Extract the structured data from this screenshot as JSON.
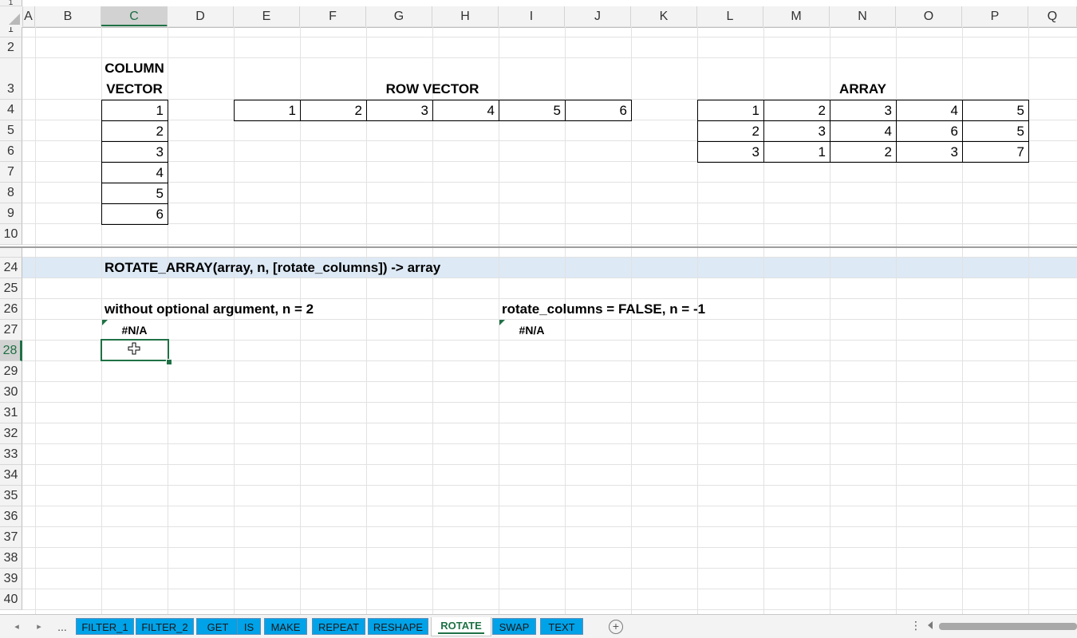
{
  "columns": [
    "A",
    "B",
    "C",
    "D",
    "E",
    "F",
    "G",
    "H",
    "I",
    "J",
    "K",
    "L",
    "M",
    "N",
    "O",
    "P",
    "Q"
  ],
  "selected_column": "C",
  "rows_top": [
    "1",
    "2",
    "3",
    "4",
    "5",
    "6",
    "7",
    "8",
    "9",
    "10"
  ],
  "rows_bottom": [
    "24",
    "25",
    "26",
    "27",
    "28",
    "29",
    "30",
    "31",
    "32",
    "33",
    "34",
    "35",
    "36",
    "37",
    "38",
    "39",
    "40"
  ],
  "selected_row": "28",
  "header_frozen_row": "1",
  "labels": {
    "column_vector_line1": "COLUMN",
    "column_vector_line2": "VECTOR",
    "row_vector": "ROW VECTOR",
    "array": "ARRAY",
    "function_signature": "ROTATE_ARRAY(array, n, [rotate_columns]) -> array",
    "example1": "without optional argument, n = 2",
    "example2": "rotate_columns = FALSE, n = -1",
    "result1": "#N/A",
    "result2": "#N/A"
  },
  "column_vector": [
    "1",
    "2",
    "3",
    "4",
    "5",
    "6"
  ],
  "row_vector": [
    "1",
    "2",
    "3",
    "4",
    "5",
    "6"
  ],
  "array": [
    [
      "1",
      "2",
      "3",
      "4",
      "5"
    ],
    [
      "2",
      "3",
      "4",
      "6",
      "5"
    ],
    [
      "3",
      "1",
      "2",
      "3",
      "7"
    ]
  ],
  "tabs": {
    "more": "...",
    "items": [
      "FILTER_1",
      "FILTER_2",
      "GET",
      "IS",
      "MAKE",
      "REPEAT",
      "RESHAPE",
      "ROTATE",
      "SWAP",
      "TEXT"
    ],
    "active": "ROTATE",
    "add": "+",
    "options": "⋮"
  },
  "colors": {
    "accent": "#1f7145",
    "tab_bg": "#00a2e8",
    "band": "#dde9f5"
  }
}
